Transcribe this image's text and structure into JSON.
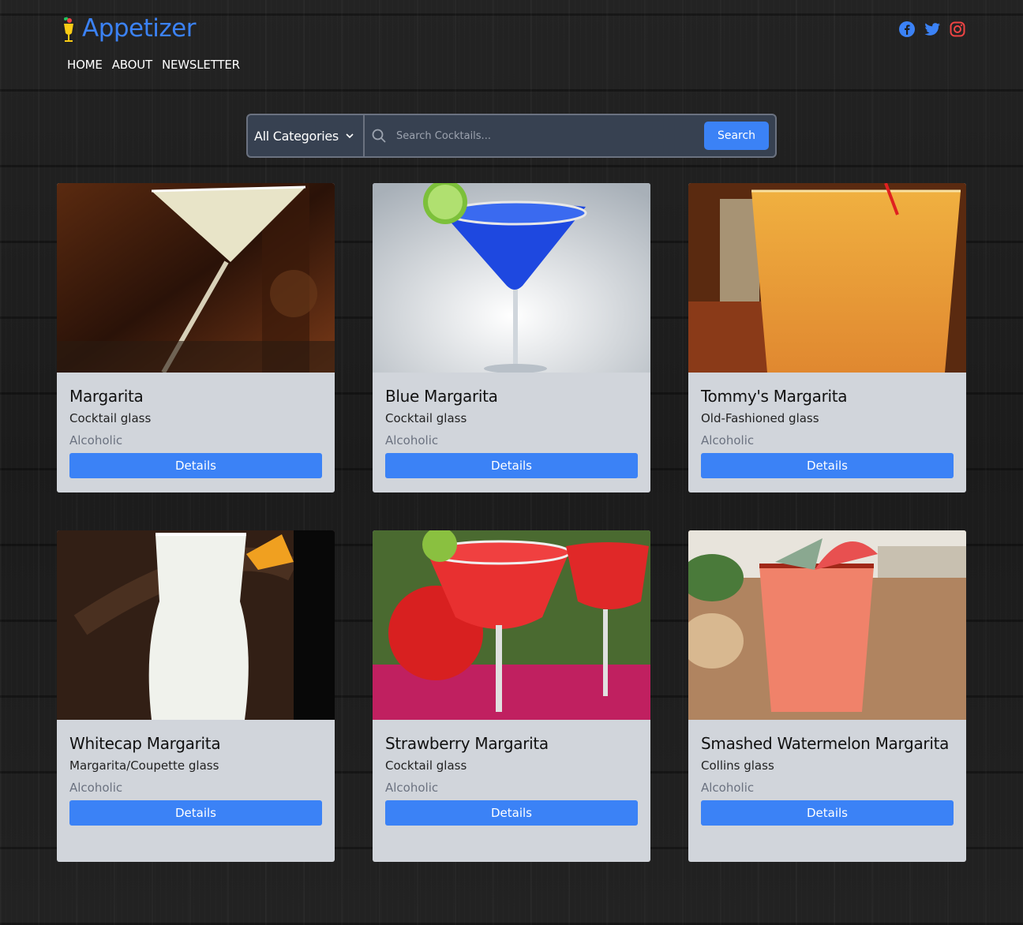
{
  "brand": {
    "name": "Appetizer",
    "accent": "#3b82f6"
  },
  "nav": {
    "items": [
      "HOME",
      "ABOUT",
      "NEWSLETTER"
    ]
  },
  "social": {
    "icons": [
      "facebook-icon",
      "twitter-icon",
      "instagram-icon"
    ]
  },
  "search": {
    "category_label": "All Categories",
    "placeholder": "Search Cocktails...",
    "button_label": "Search"
  },
  "cards": [
    {
      "title": "Margarita",
      "glass": "Cocktail glass",
      "type": "Alcoholic",
      "button": "Details"
    },
    {
      "title": "Blue Margarita",
      "glass": "Cocktail glass",
      "type": "Alcoholic",
      "button": "Details"
    },
    {
      "title": "Tommy's Margarita",
      "glass": "Old-Fashioned glass",
      "type": "Alcoholic",
      "button": "Details"
    },
    {
      "title": "Whitecap Margarita",
      "glass": "Margarita/Coupette glass",
      "type": "Alcoholic",
      "button": "Details"
    },
    {
      "title": "Strawberry Margarita",
      "glass": "Cocktail glass",
      "type": "Alcoholic",
      "button": "Details"
    },
    {
      "title": "Smashed Watermelon Margarita",
      "glass": "Collins glass",
      "type": "Alcoholic",
      "button": "Details"
    }
  ]
}
